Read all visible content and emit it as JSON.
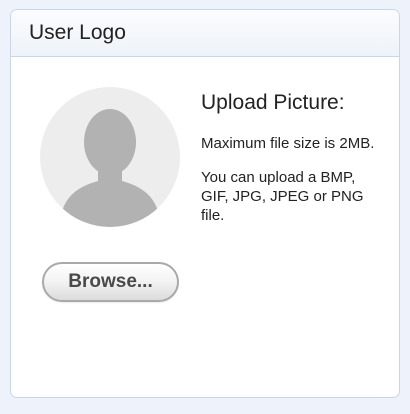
{
  "panel": {
    "title": "User Logo"
  },
  "avatar": {
    "icon": "user-silhouette-icon",
    "background_color": "#ededed",
    "figure_color": "#b2b2b2"
  },
  "browse_button": {
    "label": "Browse..."
  },
  "upload_info": {
    "title": "Upload Picture:",
    "max_size_text": "Maximum file size is 2MB.",
    "formats_text": "You can upload a BMP, GIF, JPG, JPEG or PNG file."
  }
}
